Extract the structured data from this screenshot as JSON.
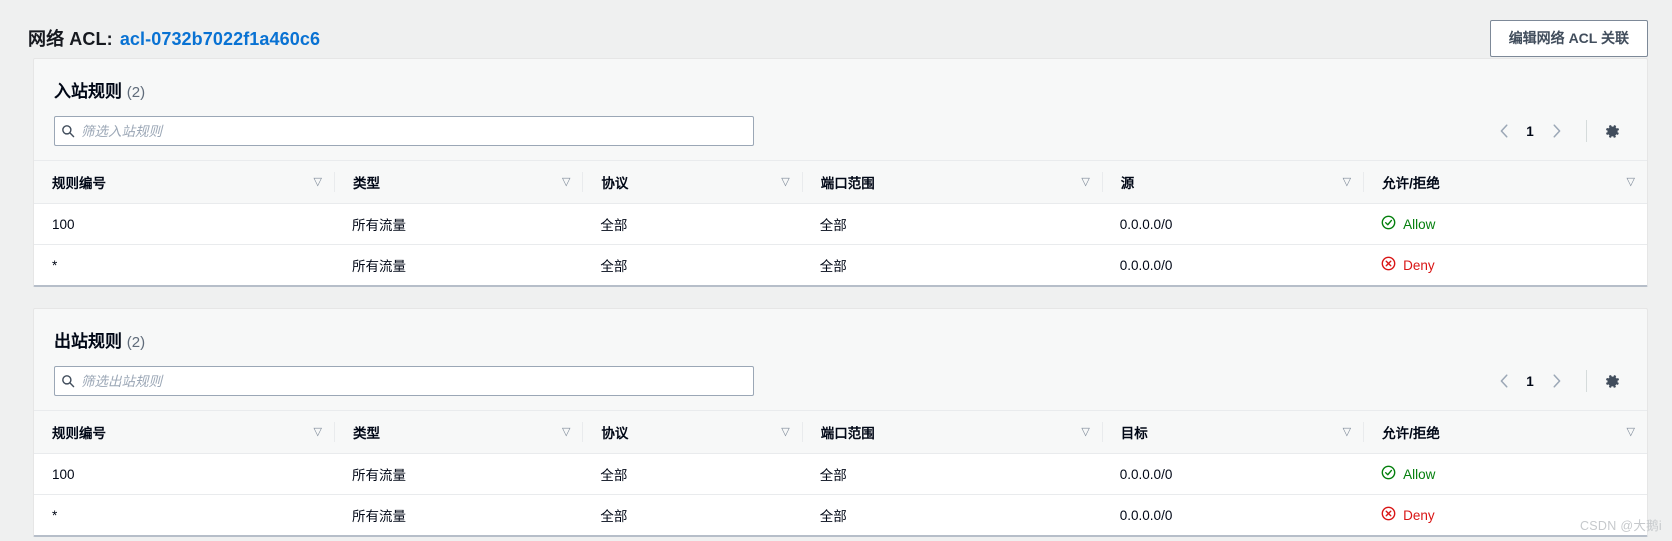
{
  "header": {
    "title_prefix": "网络 ACL:",
    "acl_id": "acl-0732b7022f1a460c6",
    "edit_button": "编辑网络 ACL 关联"
  },
  "inbound": {
    "title": "入站规则",
    "count": "(2)",
    "search_placeholder": "筛选入站规则",
    "search_value": "",
    "page_number": "1",
    "columns": [
      "规则编号",
      "类型",
      "协议",
      "端口范围",
      "源",
      "允许/拒绝"
    ],
    "rows": [
      {
        "rule_number": "100",
        "type": "所有流量",
        "protocol": "全部",
        "port_range": "全部",
        "source": "0.0.0.0/0",
        "verdict": "Allow",
        "verdict_state": "allow"
      },
      {
        "rule_number": "*",
        "type": "所有流量",
        "protocol": "全部",
        "port_range": "全部",
        "source": "0.0.0.0/0",
        "verdict": "Deny",
        "verdict_state": "deny"
      }
    ]
  },
  "outbound": {
    "title": "出站规则",
    "count": "(2)",
    "search_placeholder": "筛选出站规则",
    "search_value": "",
    "page_number": "1",
    "columns": [
      "规则编号",
      "类型",
      "协议",
      "端口范围",
      "目标",
      "允许/拒绝"
    ],
    "rows": [
      {
        "rule_number": "100",
        "type": "所有流量",
        "protocol": "全部",
        "port_range": "全部",
        "destination": "0.0.0.0/0",
        "verdict": "Allow",
        "verdict_state": "allow"
      },
      {
        "rule_number": "*",
        "type": "所有流量",
        "protocol": "全部",
        "port_range": "全部",
        "destination": "0.0.0.0/0",
        "verdict": "Deny",
        "verdict_state": "deny"
      }
    ]
  },
  "watermark": "CSDN @大鹅i",
  "colors": {
    "link": "#0972d3",
    "allow": "#037f0c",
    "deny": "#d91515",
    "page_bg": "#eff0f0",
    "card_bg": "#f7f8f8"
  }
}
